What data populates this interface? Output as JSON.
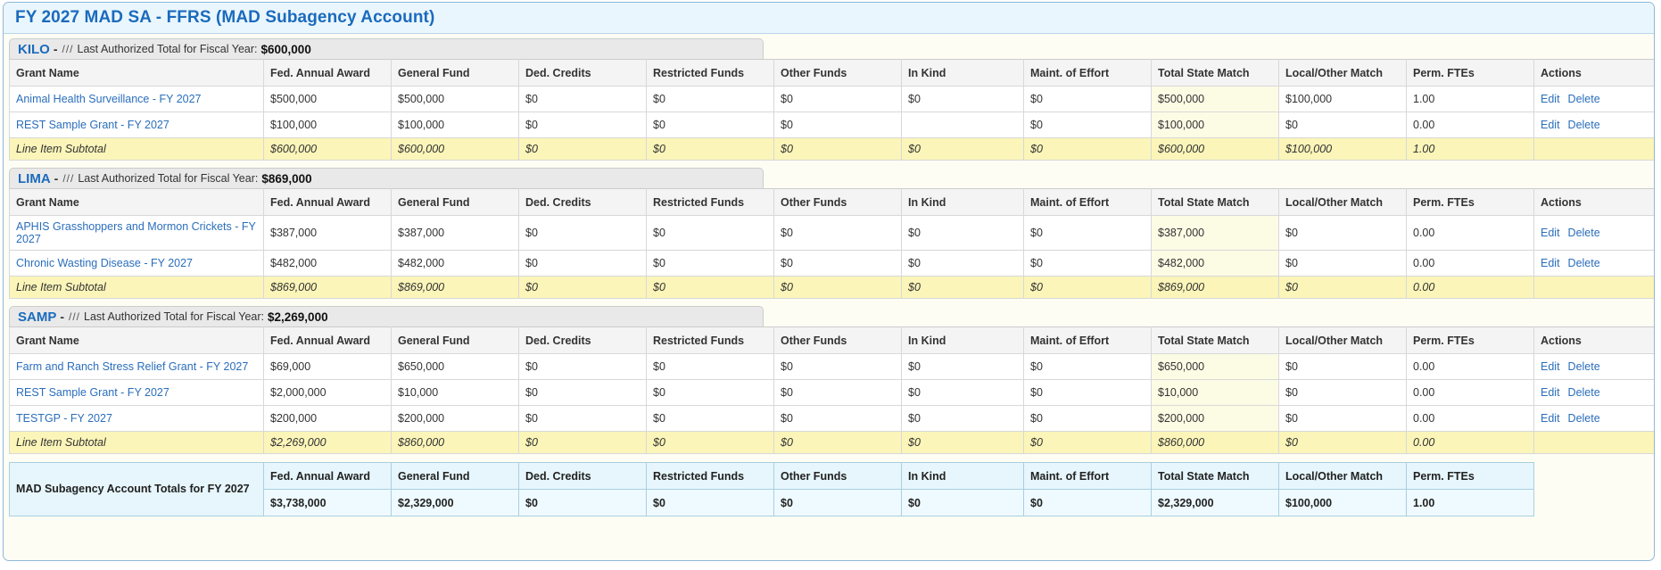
{
  "page": {
    "title": "FY 2027 MAD SA - FFRS (MAD Subagency Account)"
  },
  "columns": {
    "grant_name": "Grant Name",
    "fed_annual_award": "Fed. Annual Award",
    "general_fund": "General Fund",
    "ded_credits": "Ded. Credits",
    "restricted_funds": "Restricted Funds",
    "other_funds": "Other Funds",
    "in_kind": "In Kind",
    "maint_of_effort": "Maint. of Effort",
    "total_state_match": "Total State Match",
    "local_other_match": "Local/Other Match",
    "perm_ftes": "Perm. FTEs",
    "actions": "Actions"
  },
  "row_actions": {
    "edit": "Edit",
    "delete": "Delete"
  },
  "subtotal_label": "Line Item Subtotal",
  "section_meta": {
    "dash": "-",
    "slashes": "///",
    "last_authorized_label": "Last Authorized Total for Fiscal Year:"
  },
  "sections": [
    {
      "code": "KILO",
      "last_authorized_total": "$600,000",
      "rows": [
        {
          "grant_name": "Animal Health Surveillance - FY 2027",
          "fed_annual_award": "$500,000",
          "general_fund": "$500,000",
          "ded_credits": "$0",
          "restricted_funds": "$0",
          "other_funds": "$0",
          "in_kind": "$0",
          "maint_of_effort": "$0",
          "total_state_match": "$500,000",
          "local_other_match": "$100,000",
          "perm_ftes": "1.00"
        },
        {
          "grant_name": "REST Sample Grant - FY 2027",
          "fed_annual_award": "$100,000",
          "general_fund": "$100,000",
          "ded_credits": "$0",
          "restricted_funds": "$0",
          "other_funds": "$0",
          "in_kind": "",
          "maint_of_effort": "$0",
          "total_state_match": "$100,000",
          "local_other_match": "$0",
          "perm_ftes": "0.00"
        }
      ],
      "subtotal": {
        "grant_name": "Line Item Subtotal",
        "fed_annual_award": "$600,000",
        "general_fund": "$600,000",
        "ded_credits": "$0",
        "restricted_funds": "$0",
        "other_funds": "$0",
        "in_kind": "$0",
        "maint_of_effort": "$0",
        "total_state_match": "$600,000",
        "local_other_match": "$100,000",
        "perm_ftes": "1.00"
      }
    },
    {
      "code": "LIMA",
      "last_authorized_total": "$869,000",
      "rows": [
        {
          "grant_name": "APHIS Grasshoppers and Mormon Crickets - FY 2027",
          "fed_annual_award": "$387,000",
          "general_fund": "$387,000",
          "ded_credits": "$0",
          "restricted_funds": "$0",
          "other_funds": "$0",
          "in_kind": "$0",
          "maint_of_effort": "$0",
          "total_state_match": "$387,000",
          "local_other_match": "$0",
          "perm_ftes": "0.00"
        },
        {
          "grant_name": "Chronic Wasting Disease - FY 2027",
          "fed_annual_award": "$482,000",
          "general_fund": "$482,000",
          "ded_credits": "$0",
          "restricted_funds": "$0",
          "other_funds": "$0",
          "in_kind": "$0",
          "maint_of_effort": "$0",
          "total_state_match": "$482,000",
          "local_other_match": "$0",
          "perm_ftes": "0.00"
        }
      ],
      "subtotal": {
        "grant_name": "Line Item Subtotal",
        "fed_annual_award": "$869,000",
        "general_fund": "$869,000",
        "ded_credits": "$0",
        "restricted_funds": "$0",
        "other_funds": "$0",
        "in_kind": "$0",
        "maint_of_effort": "$0",
        "total_state_match": "$869,000",
        "local_other_match": "$0",
        "perm_ftes": "0.00"
      }
    },
    {
      "code": "SAMP",
      "last_authorized_total": "$2,269,000",
      "rows": [
        {
          "grant_name": "Farm and Ranch Stress Relief Grant - FY 2027",
          "fed_annual_award": "$69,000",
          "general_fund": "$650,000",
          "ded_credits": "$0",
          "restricted_funds": "$0",
          "other_funds": "$0",
          "in_kind": "$0",
          "maint_of_effort": "$0",
          "total_state_match": "$650,000",
          "local_other_match": "$0",
          "perm_ftes": "0.00"
        },
        {
          "grant_name": "REST Sample Grant - FY 2027",
          "fed_annual_award": "$2,000,000",
          "general_fund": "$10,000",
          "ded_credits": "$0",
          "restricted_funds": "$0",
          "other_funds": "$0",
          "in_kind": "$0",
          "maint_of_effort": "$0",
          "total_state_match": "$10,000",
          "local_other_match": "$0",
          "perm_ftes": "0.00"
        },
        {
          "grant_name": "TESTGP - FY 2027",
          "fed_annual_award": "$200,000",
          "general_fund": "$200,000",
          "ded_credits": "$0",
          "restricted_funds": "$0",
          "other_funds": "$0",
          "in_kind": "$0",
          "maint_of_effort": "$0",
          "total_state_match": "$200,000",
          "local_other_match": "$0",
          "perm_ftes": "0.00"
        }
      ],
      "subtotal": {
        "grant_name": "Line Item Subtotal",
        "fed_annual_award": "$2,269,000",
        "general_fund": "$860,000",
        "ded_credits": "$0",
        "restricted_funds": "$0",
        "other_funds": "$0",
        "in_kind": "$0",
        "maint_of_effort": "$0",
        "total_state_match": "$860,000",
        "local_other_match": "$0",
        "perm_ftes": "0.00"
      }
    }
  ],
  "grand_totals": {
    "label": "MAD Subagency Account Totals for FY 2027",
    "fed_annual_award": "$3,738,000",
    "general_fund": "$2,329,000",
    "ded_credits": "$0",
    "restricted_funds": "$0",
    "other_funds": "$0",
    "in_kind": "$0",
    "maint_of_effort": "$0",
    "total_state_match": "$2,329,000",
    "local_other_match": "$100,000",
    "perm_ftes": "1.00"
  },
  "colors": {
    "title_text": "#1a6bbd",
    "title_bg": "#eaf6fd",
    "link": "#2a6ebb",
    "subtotal_bg": "#fbf5b9",
    "tsm_highlight": "#fcfbe4",
    "totals_bg": "#e6f6fc",
    "panel_bg": "#fdfdf4"
  }
}
